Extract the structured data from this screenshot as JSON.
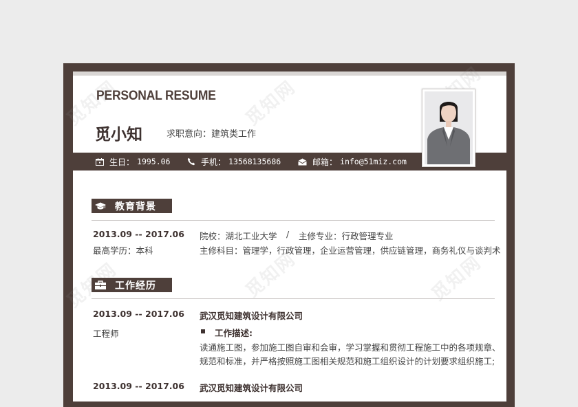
{
  "header": {
    "title": "PERSONAL RESUME",
    "name": "觅小知",
    "job_intent": "求职意向：建筑类工作"
  },
  "info": {
    "birth_label": "生日：",
    "birth_value": "1995.06",
    "phone_label": "手机：",
    "phone_value": "13568135686",
    "email_label": "邮箱：",
    "email_value": "info@51miz.com"
  },
  "education": {
    "heading": "教育背景",
    "period": "2013.09 -- 2017.06",
    "degree": "最高学历：本科",
    "school": "院校：湖北工业大学",
    "separator": "/",
    "major": "主修专业：行政管理专业",
    "courses": "主修科目：管理学，行政管理，企业运营管理，供应链管理，商务礼仪与谈判术"
  },
  "work": {
    "heading": "工作经历",
    "jobs": [
      {
        "period": "2013.09 -- 2017.06",
        "title": "工程师",
        "company": "武汉觅知建筑设计有限公司",
        "desc_label": "工作描述:",
        "desc_line1": "读通施工图，参加施工图自审和会审，学习掌握和贯彻工程施工中的各项规章、",
        "desc_line2": "规范和标准，并严格按照施工图相关规范和施工组织设计的计划要求组织施工;"
      },
      {
        "period": "2013.09 -- 2017.06",
        "company": "武汉觅知建筑设计有限公司"
      }
    ]
  },
  "watermark": "觅知网",
  "colors": {
    "accent": "#4e3f3a",
    "paper": "#ffffff",
    "background": "#ececec"
  }
}
